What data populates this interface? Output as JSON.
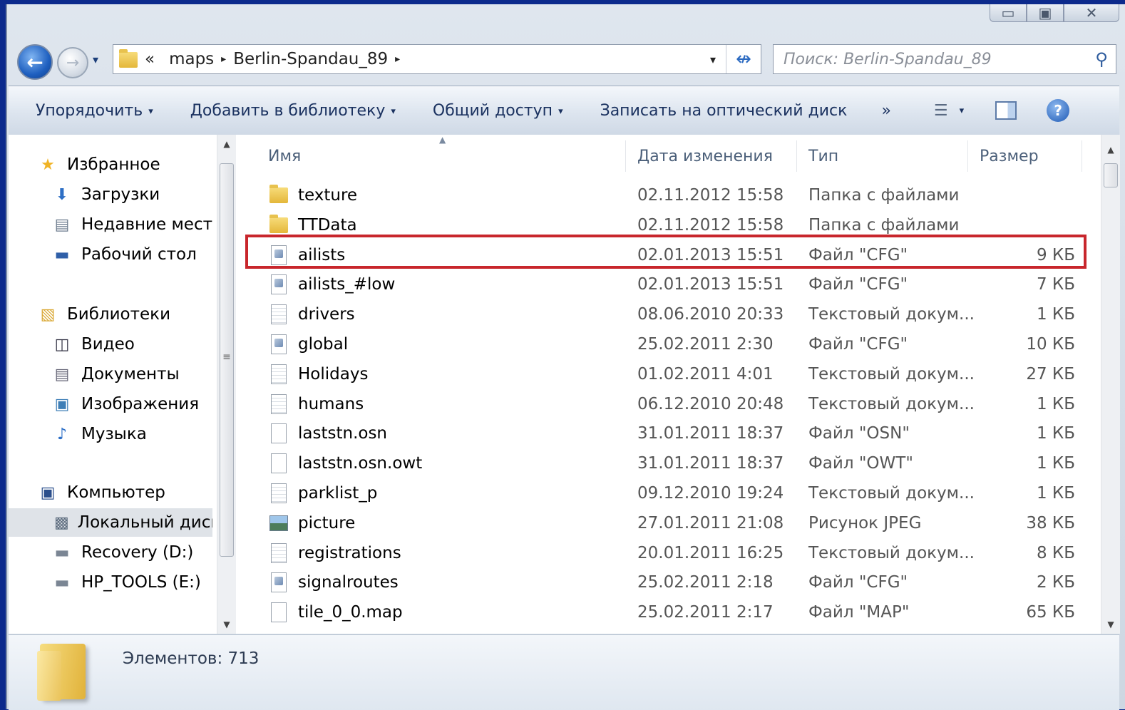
{
  "window": {
    "caption": {
      "minimize": "▭",
      "maximize": "▣",
      "close": "✕"
    }
  },
  "nav": {
    "back": "←",
    "forward": "→",
    "recent_dropdown": "▾",
    "address": {
      "overflow": "«",
      "crumbs": [
        "maps",
        "Berlin-Spandau_89"
      ],
      "separator": "▸",
      "dropdown": "▾",
      "refresh": "↮"
    },
    "search": {
      "placeholder": "Поиск: Berlin-Spandau_89",
      "icon": "search-icon"
    }
  },
  "toolbar": {
    "organize": "Упорядочить",
    "add_to_library": "Добавить в библиотеку",
    "share": "Общий доступ",
    "burn": "Записать на оптический диск",
    "more": "»",
    "dropdown_arrow": "▾",
    "help": "?"
  },
  "sidebar": {
    "favorites": {
      "label": "Избранное",
      "items": [
        "Загрузки",
        "Недавние места",
        "Рабочий стол"
      ]
    },
    "libraries": {
      "label": "Библиотеки",
      "items": [
        "Видео",
        "Документы",
        "Изображения",
        "Музыка"
      ]
    },
    "computer": {
      "label": "Компьютер",
      "items": [
        "Локальный диск",
        "Recovery (D:)",
        "HP_TOOLS (E:)"
      ]
    }
  },
  "columns": {
    "name": "Имя",
    "date": "Дата изменения",
    "type": "Тип",
    "size": "Размер"
  },
  "files": [
    {
      "name": "texture",
      "date": "02.11.2012 15:58",
      "type": "Папка с файлами",
      "size": "",
      "icon": "folder"
    },
    {
      "name": "TTData",
      "date": "02.11.2012 15:58",
      "type": "Папка с файлами",
      "size": "",
      "icon": "folder"
    },
    {
      "name": "ailists",
      "date": "02.01.2013 15:51",
      "type": "Файл \"CFG\"",
      "size": "9 КБ",
      "icon": "cfg"
    },
    {
      "name": "ailists_#low",
      "date": "02.01.2013 15:51",
      "type": "Файл \"CFG\"",
      "size": "7 КБ",
      "icon": "cfg"
    },
    {
      "name": "drivers",
      "date": "08.06.2010 20:33",
      "type": "Текстовый докум...",
      "size": "1 КБ",
      "icon": "txt"
    },
    {
      "name": "global",
      "date": "25.02.2011 2:30",
      "type": "Файл \"CFG\"",
      "size": "10 КБ",
      "icon": "cfg"
    },
    {
      "name": "Holidays",
      "date": "01.02.2011 4:01",
      "type": "Текстовый докум...",
      "size": "27 КБ",
      "icon": "txt"
    },
    {
      "name": "humans",
      "date": "06.12.2010 20:48",
      "type": "Текстовый докум...",
      "size": "1 КБ",
      "icon": "txt"
    },
    {
      "name": "laststn.osn",
      "date": "31.01.2011 18:37",
      "type": "Файл \"OSN\"",
      "size": "1 КБ",
      "icon": "blank"
    },
    {
      "name": "laststn.osn.owt",
      "date": "31.01.2011 18:37",
      "type": "Файл \"OWT\"",
      "size": "1 КБ",
      "icon": "blank"
    },
    {
      "name": "parklist_p",
      "date": "09.12.2010 19:24",
      "type": "Текстовый докум...",
      "size": "1 КБ",
      "icon": "txt"
    },
    {
      "name": "picture",
      "date": "27.01.2011 21:08",
      "type": "Рисунок JPEG",
      "size": "38 КБ",
      "icon": "image"
    },
    {
      "name": "registrations",
      "date": "20.01.2011 16:25",
      "type": "Текстовый докум...",
      "size": "8 КБ",
      "icon": "txt"
    },
    {
      "name": "signalroutes",
      "date": "25.02.2011 2:18",
      "type": "Файл \"CFG\"",
      "size": "2 КБ",
      "icon": "cfg"
    },
    {
      "name": "tile_0_0.map",
      "date": "25.02.2011 2:17",
      "type": "Файл \"MAP\"",
      "size": "65 КБ",
      "icon": "blank"
    }
  ],
  "highlighted_file": "ailists",
  "highlight_color": "#c8262c",
  "status": {
    "items": "Элементов: 713"
  }
}
